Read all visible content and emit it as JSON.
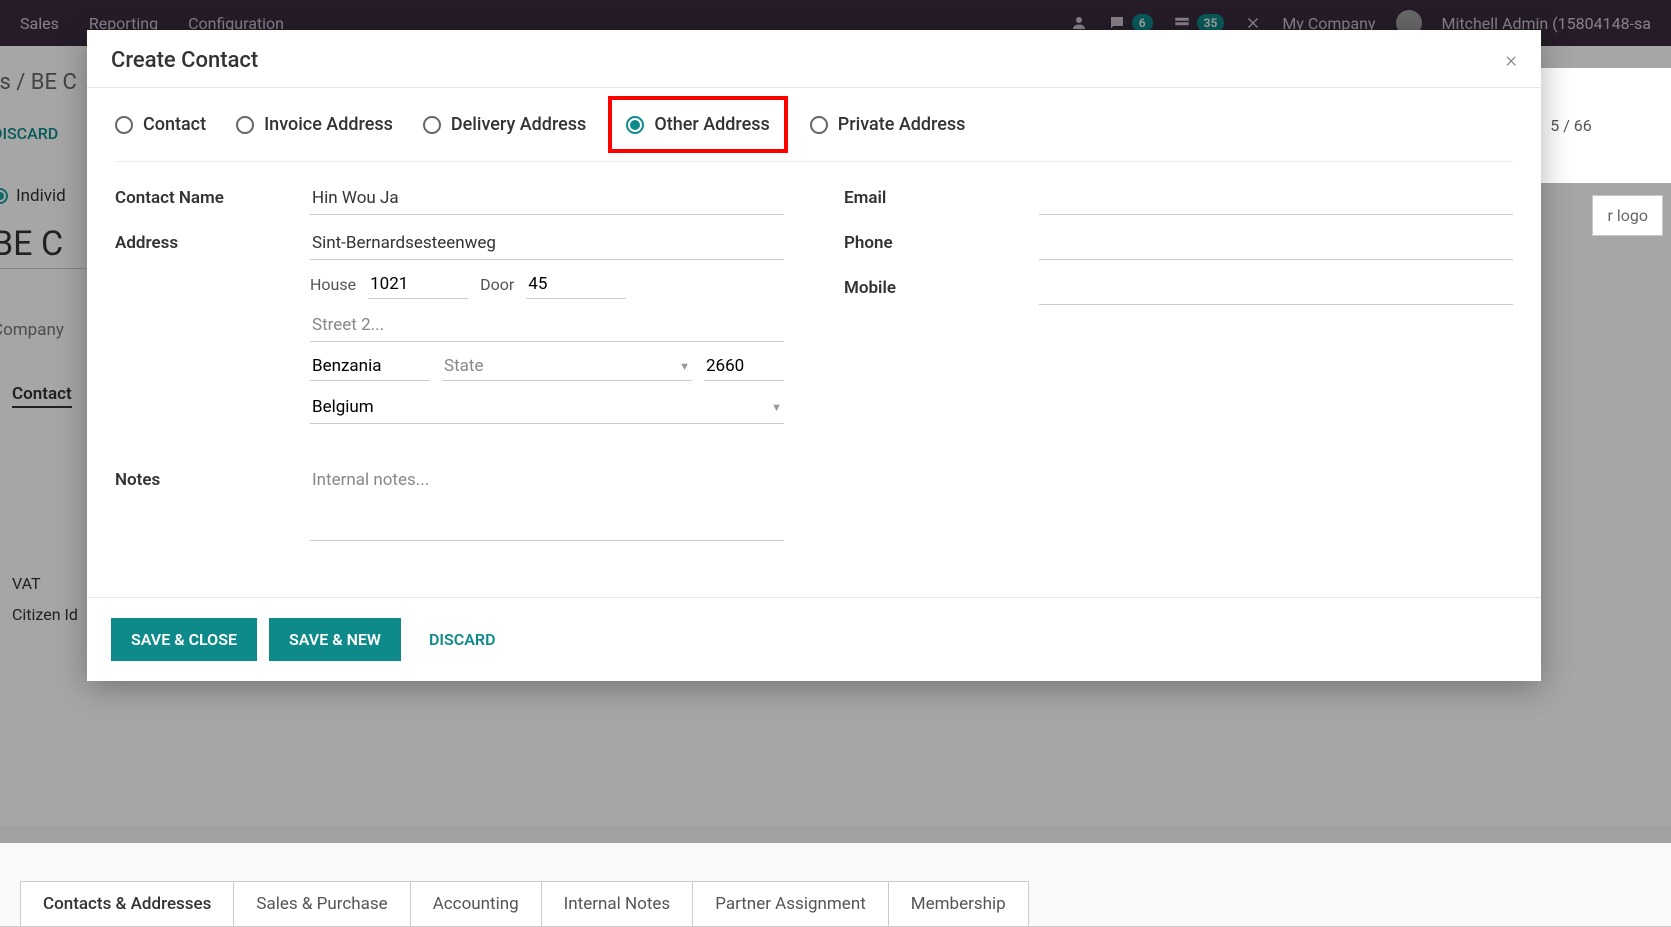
{
  "topnav": {
    "items": [
      "Sales",
      "Reporting",
      "Configuration"
    ],
    "badges": {
      "chat": "6",
      "activity": "35"
    },
    "company": "My Company",
    "user": "Mitchell Admin (15804148-sa"
  },
  "breadcrumb": "rs / BE C",
  "discard_link": "DISCARD",
  "pager": "5 / 66",
  "bg": {
    "radio_label": "Individ",
    "big_name": "BE C",
    "company_ph": "Company",
    "logo_ph": "r logo",
    "contact_tab": "Contact",
    "vat_label": "VAT",
    "citizen_label": "Citizen Id"
  },
  "tabs": [
    "Contacts & Addresses",
    "Sales & Purchase",
    "Accounting",
    "Internal Notes",
    "Partner Assignment",
    "Membership"
  ],
  "modal": {
    "title": "Create Contact",
    "close": "×",
    "radios": {
      "contact": "Contact",
      "invoice": "Invoice Address",
      "delivery": "Delivery Address",
      "other": "Other Address",
      "private": "Private Address",
      "selected": "other"
    },
    "labels": {
      "contact_name": "Contact Name",
      "address": "Address",
      "house": "House",
      "door": "Door",
      "street2_ph": "Street 2...",
      "state_ph": "State",
      "notes": "Notes",
      "notes_ph": "Internal notes...",
      "email": "Email",
      "phone": "Phone",
      "mobile": "Mobile"
    },
    "values": {
      "contact_name": "Hin Wou Ja",
      "street": "Sint-Bernardsesteenweg",
      "house": "1021",
      "door": "45",
      "city": "Benzania",
      "zip": "2660",
      "country": "Belgium"
    },
    "footer": {
      "save_close": "SAVE & CLOSE",
      "save_new": "SAVE & NEW",
      "discard": "DISCARD"
    }
  }
}
